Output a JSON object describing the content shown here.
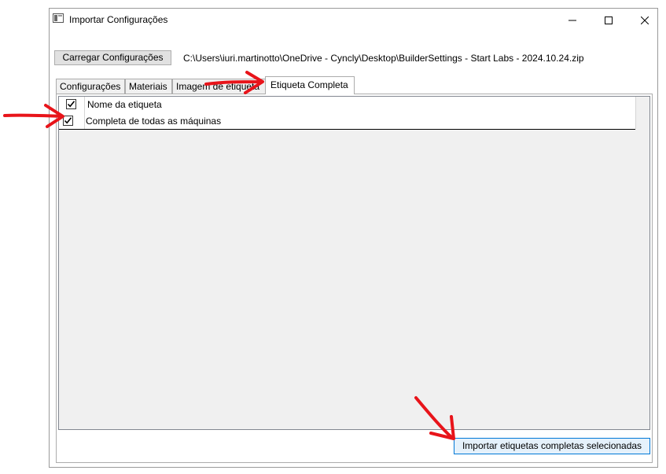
{
  "window": {
    "title": "Importar Configurações",
    "controls": [
      "minimize-icon",
      "maximize-icon",
      "close-icon"
    ]
  },
  "toolbar": {
    "load_button_label": "Carregar Configurações",
    "file_path": "C:\\Users\\iuri.martinotto\\OneDrive - Cyncly\\Desktop\\BuilderSettings - Start Labs - 2024.10.24.zip"
  },
  "tabs": [
    {
      "label": "Configurações",
      "active": false
    },
    {
      "label": "Materiais",
      "active": false
    },
    {
      "label": "Imagem de etiqueta",
      "active": false
    },
    {
      "label": "Etiqueta Completa",
      "active": true
    }
  ],
  "grid": {
    "header": {
      "label": "Nome da etiqueta",
      "checked": true
    },
    "rows": [
      {
        "label": "Completa de todas as máquinas",
        "checked": true
      }
    ]
  },
  "footer": {
    "import_button_label": "Importar etiquetas completas selecionadas"
  },
  "colors": {
    "annotation_arrow": "#e8141a",
    "import_button_bg": "#e5f1fb",
    "import_button_border": "#0078d7"
  }
}
